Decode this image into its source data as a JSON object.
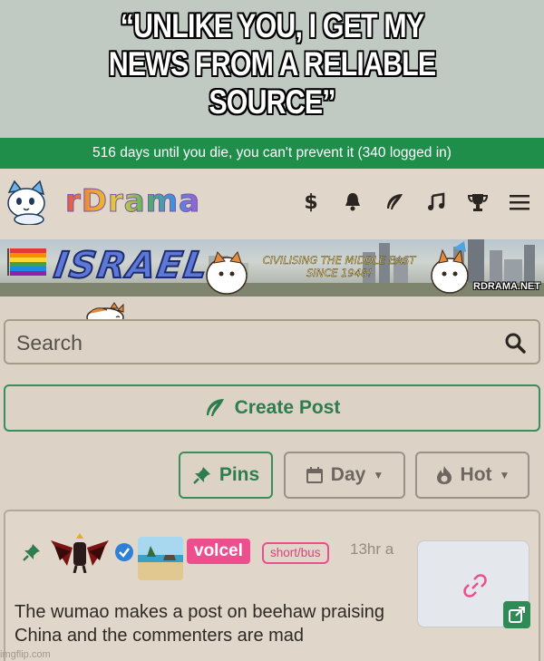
{
  "meme": {
    "caption_line1": "“UNLIKE YOU, I GET MY",
    "caption_line2": "NEWS FROM A RELIABLE SOURCE”"
  },
  "banner": {
    "text": "516 days until you die, you can't prevent it (340 logged in)"
  },
  "header": {
    "logo_text": "rDrama",
    "icons": [
      "dollar-icon",
      "bell-icon",
      "leaf-icon",
      "music-note-icon",
      "trophy-icon",
      "menu-icon"
    ],
    "dollar_glyph": "$"
  },
  "hero": {
    "title": "ISRAEL",
    "slogan_line1": "CIVILISING THE MIDDLE EAST",
    "slogan_line2": "SINCE 1948!",
    "site": "RDRAMA.NET"
  },
  "search": {
    "placeholder": "Search"
  },
  "create_post": {
    "label": "Create Post"
  },
  "filters": {
    "pins_label": "Pins",
    "day_label": "Day",
    "hot_label": "Hot"
  },
  "post": {
    "username": "volcel",
    "flair": "short/bus",
    "timestamp": "13hr a",
    "title": "The wumao makes a post on beehaw praising China and the commenters are mad"
  },
  "watermark": "imgflip.com",
  "colors": {
    "banner_green": "#1f8e4b",
    "accent_green": "#2e7d4f",
    "username_pink": "#ec4e8e",
    "page_bg": "#ddd2c6"
  }
}
